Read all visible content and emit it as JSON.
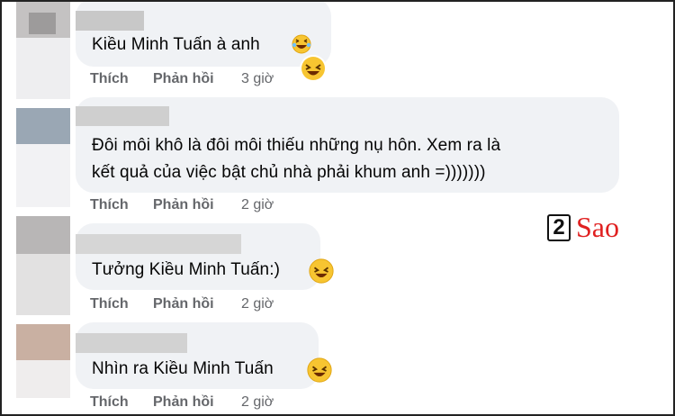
{
  "comments": [
    {
      "text": [
        "Kiều Minh Tuấn à anh"
      ],
      "like": "Thích",
      "reply": "Phản hồi",
      "time": "3 giờ"
    },
    {
      "text": [
        "Đôi môi khô là đôi môi thiếu những nụ hôn. Xem ra là",
        "kết quả của việc bật chủ nhà phải khum anh =)))))))"
      ],
      "like": "Thích",
      "reply": "Phản hồi",
      "time": "2 giờ"
    },
    {
      "text": [
        "Tưởng Kiều Minh Tuấn:)"
      ],
      "like": "Thích",
      "reply": "Phản hồi",
      "time": "2 giờ"
    },
    {
      "text": [
        "Nhìn ra Kiều Minh Tuấn"
      ],
      "like": "Thích",
      "reply": "Phản hồi",
      "time": "2 giờ"
    }
  ],
  "watermark": {
    "digit": "2",
    "word": "Sao"
  },
  "colors": {
    "bubble": "#f0f2f5",
    "action_text": "#65676b",
    "logo_red": "#e02020"
  },
  "icons": {
    "reaction": "laughing-face-icon"
  }
}
